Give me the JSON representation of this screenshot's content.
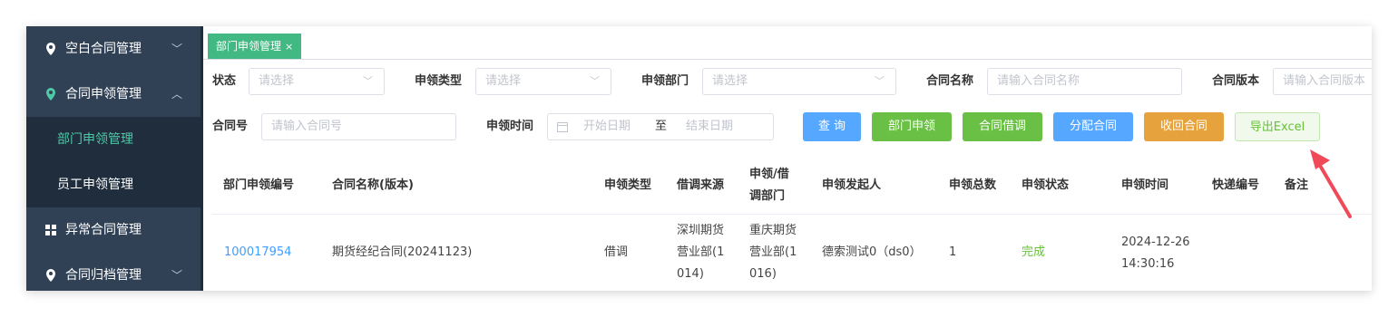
{
  "sidebar": {
    "items": [
      {
        "label": "空白合同管理",
        "icon": "location-pin-icon",
        "arrow": "﹀"
      },
      {
        "label": "合同申领管理",
        "icon": "location-pin-icon",
        "arrow": "︿"
      },
      {
        "label": "部门申领管理"
      },
      {
        "label": "员工申领管理"
      },
      {
        "label": "异常合同管理",
        "icon": "grid-icon"
      },
      {
        "label": "合同归档管理",
        "icon": "location-pin-icon",
        "arrow": "﹀"
      }
    ]
  },
  "tabs": [
    {
      "label": "部门申领管理",
      "close": "×"
    }
  ],
  "filters": {
    "status": {
      "label": "状态",
      "placeholder": "请选择"
    },
    "apply_type": {
      "label": "申领类型",
      "placeholder": "请选择"
    },
    "apply_dept": {
      "label": "申领部门",
      "placeholder": "请选择"
    },
    "contract_name": {
      "label": "合同名称",
      "placeholder": "请输入合同名称"
    },
    "contract_version": {
      "label": "合同版本",
      "placeholder": "请输入合同版本"
    },
    "contract_no": {
      "label": "合同号",
      "placeholder": "请输入合同号"
    },
    "apply_time": {
      "label": "申领时间",
      "start": "开始日期",
      "sep": "至",
      "end": "结束日期"
    }
  },
  "buttons": {
    "query": "查 询",
    "dept_apply": "部门申领",
    "borrow": "合同借调",
    "assign": "分配合同",
    "recall": "收回合同",
    "export": "导出Excel"
  },
  "table": {
    "headers": [
      "部门申领编号",
      "合同名称(版本)",
      "申领类型",
      "借调来源",
      "申领/借调部门",
      "申领发起人",
      "申领总数",
      "申领状态",
      "申领时间",
      "快递编号",
      "备注"
    ],
    "header_lines": {
      "source": "借调来源",
      "dept_1": "申领/借",
      "dept_2": "调部门"
    },
    "rows": [
      {
        "id": "100017954",
        "name": "期货经纪合同(20241123)",
        "type": "借调",
        "source": [
          "深圳期货",
          "营业部(1",
          "014)"
        ],
        "dept": [
          "重庆期货",
          "营业部(1",
          "016)"
        ],
        "initiator": "德索测试0（ds0）",
        "total": "1",
        "status": "完成",
        "time": [
          "2024-12-26",
          "14:30:16"
        ],
        "express": "",
        "remark": ""
      }
    ]
  },
  "colors": {
    "sidebar": "#304156",
    "accent": "#42b983",
    "link": "#409eff",
    "success": "#67c23a",
    "arrow": "#f04a5a"
  }
}
